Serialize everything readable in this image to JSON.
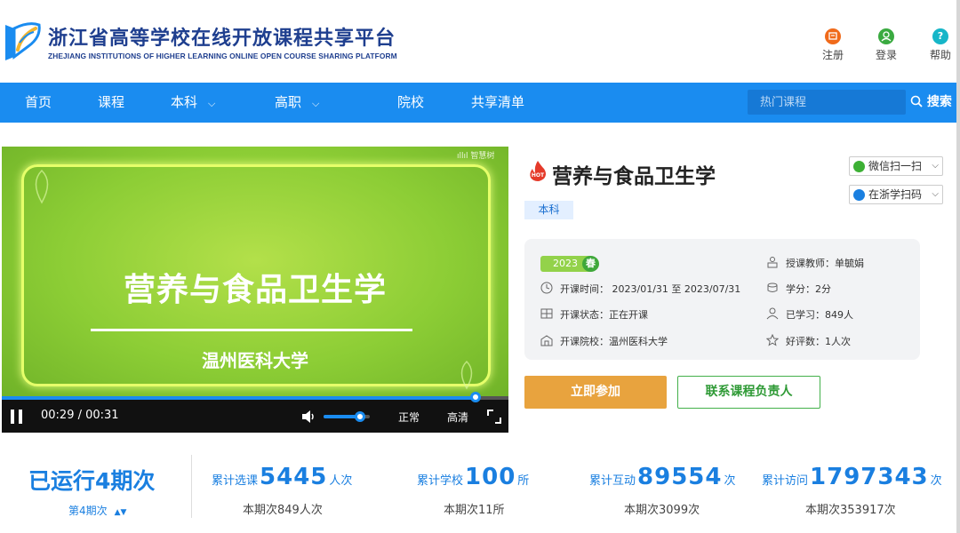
{
  "header": {
    "title": "浙江省高等学校在线开放课程共享平台",
    "subtitle": "ZHEJIANG INSTITUTIONS OF HIGHER LEARNING ONLINE OPEN COURSE SHARING PLATFORM",
    "register_label": "注册",
    "login_label": "登录",
    "help_label": "帮助",
    "help_icon_glyph": "?"
  },
  "nav": {
    "items": [
      {
        "label": "首页"
      },
      {
        "label": "课程"
      },
      {
        "label": "本科"
      },
      {
        "label": "高职"
      },
      {
        "label": "院校"
      },
      {
        "label": "共享清单"
      }
    ],
    "chevron": "⌵",
    "search_placeholder": "热门课程",
    "search_label": "搜索"
  },
  "video": {
    "title": "营养与食品卫生学",
    "subtitle": "温州医科大学",
    "watermark": "ıllıl 智慧树",
    "time": "00:29 / 00:31",
    "progress": 0.935,
    "volume": 0.78,
    "speed_label": "正常",
    "quality_label": "高清"
  },
  "course": {
    "title": "营养与食品卫生学",
    "level": "本科",
    "wechat_label": "微信扫一扫",
    "zheda_label": "在浙学扫码",
    "year": "2023",
    "season": "春",
    "teacher": "授课教师：单毓娟",
    "open_time": "开课时间：  2023/01/31 至 2023/07/31",
    "credit": "学分：2分",
    "status": "开课状态：正在开课",
    "learned": "已学习：849人",
    "school": "开课院校：温州医科大学",
    "rating": "好评数：1人次",
    "join_label": "立即参加",
    "contact_label": "联系课程负责人"
  },
  "stats": {
    "run_count": "已运行4期次",
    "period": "第4期次",
    "period_arrows": "▲▼",
    "items": [
      {
        "label": "累计选课",
        "value": "5445",
        "unit": "人次",
        "sub": "本期次849人次"
      },
      {
        "label": "累计学校",
        "value": "100",
        "unit": "所",
        "sub": "本期次11所"
      },
      {
        "label": "累计互动",
        "value": "89554",
        "unit": "次",
        "sub": "本期次3099次"
      },
      {
        "label": "累计访问",
        "value": "1797343",
        "unit": "次",
        "sub": "本期次353917次"
      }
    ]
  },
  "colors": {
    "brand_blue": "#1a8cf0",
    "join_orange": "#e8a33e",
    "contact_green": "#43b04a",
    "stat_blue": "#1a7fe0"
  }
}
